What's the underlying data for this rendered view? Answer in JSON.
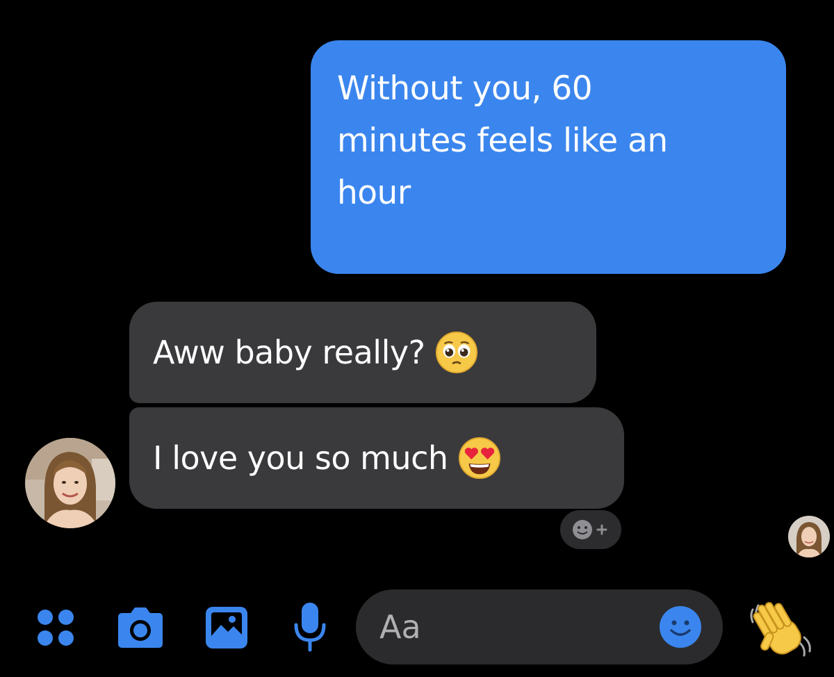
{
  "messages": {
    "outgoing": {
      "lines": [
        "Without you, 60",
        "minutes feels like an",
        "hour"
      ]
    },
    "incoming": [
      {
        "text": "Aww baby really?",
        "emoji": "pleading-face-icon"
      },
      {
        "text": "I love you so much",
        "emoji": "heart-eyes-face-icon"
      }
    ]
  },
  "composer": {
    "placeholder": "Aa"
  },
  "toolbar": {
    "icons": [
      "apps-grid-icon",
      "camera-icon",
      "gallery-icon",
      "microphone-icon",
      "emoji-icon",
      "wave-hand-icon"
    ]
  },
  "colors": {
    "outgoing_bubble": "#3b86ee",
    "incoming_bubble": "#3a3a3c",
    "accent": "#3b86ee",
    "background": "#000000"
  }
}
